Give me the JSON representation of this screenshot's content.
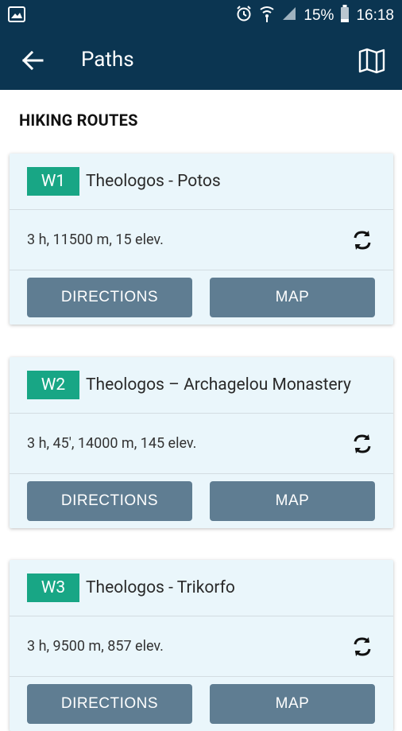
{
  "status": {
    "battery": "15%",
    "time": "16:18"
  },
  "appbar": {
    "title": "Paths"
  },
  "section": {
    "title": "HIKING ROUTES"
  },
  "routes": [
    {
      "code": "W1",
      "name": "Theologos - Potos",
      "stats": "3 h, 11500 m, 15 elev.",
      "directions": "DIRECTIONS",
      "map": "MAP"
    },
    {
      "code": "W2",
      "name": "Theologos – Archagelou Monastery",
      "stats": "3 h, 45', 14000 m, 145 elev.",
      "directions": "DIRECTIONS",
      "map": "MAP"
    },
    {
      "code": "W3",
      "name": "Theologos - Trikorfo",
      "stats": "3 h, 9500 m, 857 elev.",
      "directions": "DIRECTIONS",
      "map": "MAP"
    }
  ],
  "colors": {
    "header": "#0b3551",
    "badge": "#18a685",
    "button": "#5f7d92",
    "card": "#eaf6fb"
  }
}
